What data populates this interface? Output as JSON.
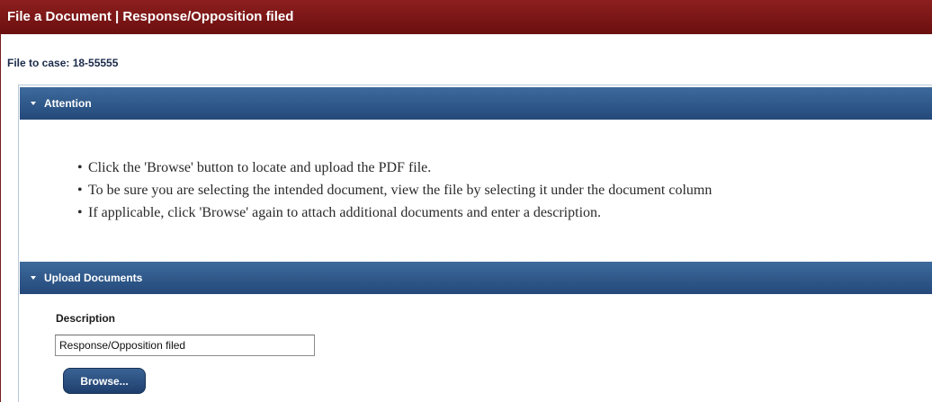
{
  "window": {
    "title": "File a Document | Response/Opposition filed"
  },
  "case": {
    "label": "File to case: 18-55555"
  },
  "attention": {
    "header": "Attention",
    "bullets": [
      "Click the 'Browse' button to locate and upload the PDF file.",
      "To be sure you are selecting the intended document, view the file by selecting it under the document column",
      "If applicable, click 'Browse' again to attach additional documents and enter a description."
    ]
  },
  "upload": {
    "header": "Upload Documents",
    "description_label": "Description",
    "description_value": "Response/Opposition filed",
    "browse_label": "Browse..."
  },
  "colors": {
    "title_bar": "#7a1515",
    "section_header": "#2f5888",
    "button": "#2b4f80"
  }
}
